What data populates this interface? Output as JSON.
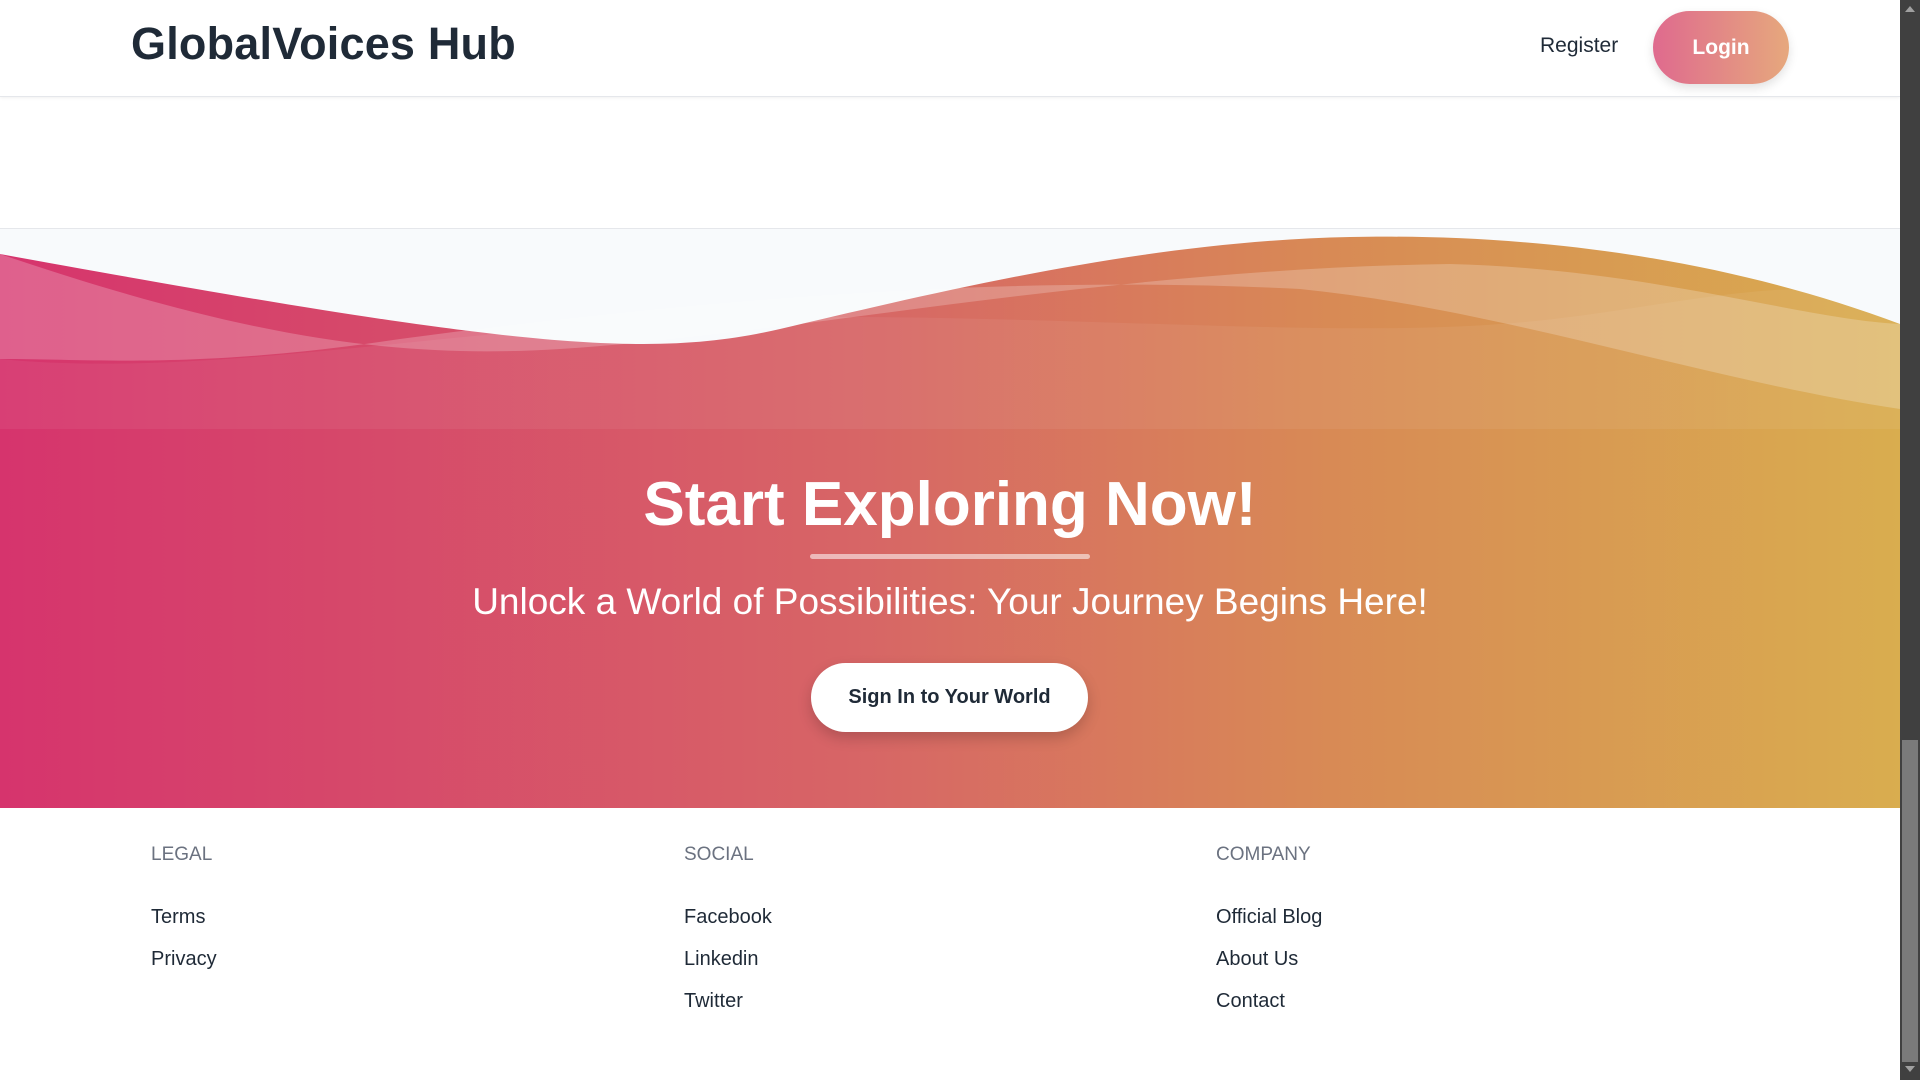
{
  "header": {
    "brand": "GlobalVoices Hub",
    "register_label": "Register",
    "login_label": "Login"
  },
  "cta": {
    "title": "Start Exploring Now!",
    "subtitle": "Unlock a World of Possibilities: Your Journey Begins Here!",
    "button_label": "Sign In to Your World"
  },
  "footer": {
    "columns": [
      {
        "heading": "LEGAL",
        "links": [
          "Terms",
          "Privacy"
        ]
      },
      {
        "heading": "SOCIAL",
        "links": [
          "Facebook",
          "Linkedin",
          "Twitter"
        ]
      },
      {
        "heading": "COMPANY",
        "links": [
          "Official Blog",
          "About Us",
          "Contact"
        ]
      }
    ]
  },
  "colors": {
    "gradient_start": "#d6346d",
    "gradient_end": "#d9ad4f",
    "text_dark": "#1f2a37"
  }
}
